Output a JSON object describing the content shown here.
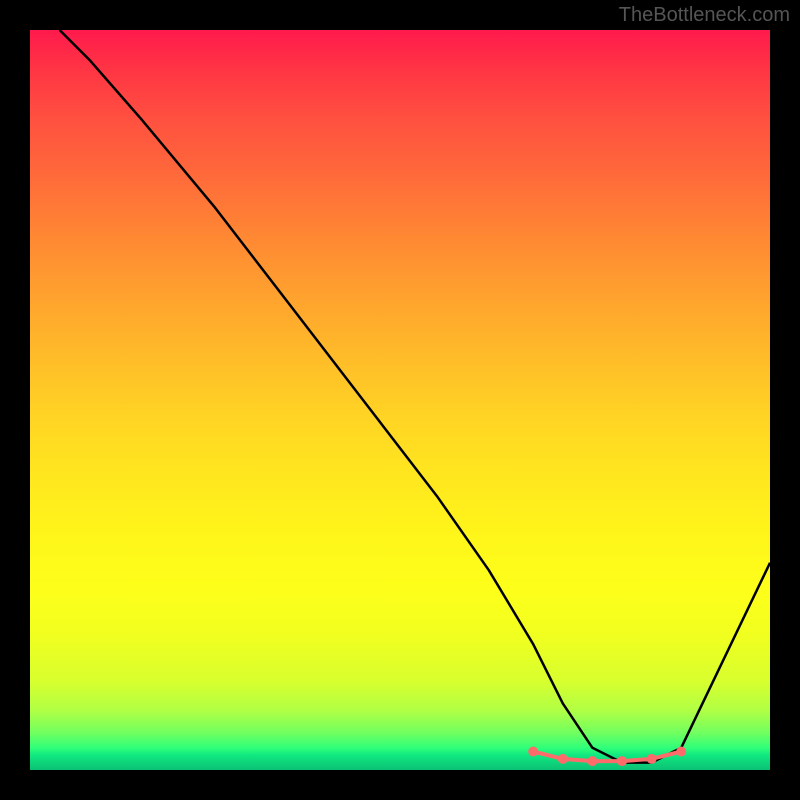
{
  "watermark": "TheBottleneck.com",
  "chart_data": {
    "type": "line",
    "title": "",
    "xlabel": "",
    "ylabel": "",
    "xlim": [
      0,
      100
    ],
    "ylim": [
      0,
      100
    ],
    "series": [
      {
        "name": "curve",
        "x": [
          4,
          8,
          15,
          25,
          35,
          45,
          55,
          62,
          68,
          72,
          76,
          80,
          84,
          88,
          100
        ],
        "y": [
          100,
          96,
          88,
          76,
          63,
          50,
          37,
          27,
          17,
          9,
          3,
          1,
          1,
          3,
          28
        ]
      }
    ],
    "highlight": {
      "x": [
        68,
        72,
        76,
        80,
        84,
        88
      ],
      "y": [
        2.5,
        1.5,
        1.2,
        1.2,
        1.5,
        2.5
      ],
      "color": "#ff6b6b"
    }
  }
}
